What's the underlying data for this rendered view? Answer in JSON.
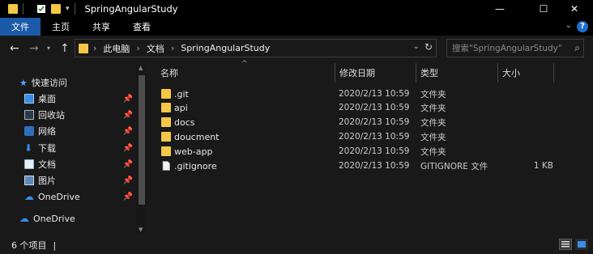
{
  "window": {
    "title": "SpringAngularStudy",
    "controls": {
      "minimize": "—",
      "maximize": "☐",
      "close": "✕"
    }
  },
  "ribbon": {
    "tabs": [
      "文件",
      "主页",
      "共享",
      "查看"
    ],
    "collapse_icon": "chevron-down-icon",
    "help": "?"
  },
  "address": {
    "crumbs": [
      "此电脑",
      "文档",
      "SpringAngularStudy"
    ],
    "search_placeholder": "搜索\"SpringAngularStudy\""
  },
  "nav": {
    "quick_access": "快速访问",
    "items": [
      {
        "label": "桌面",
        "icon": "desktop-icon",
        "pinned": true
      },
      {
        "label": "回收站",
        "icon": "recycle-bin-icon",
        "pinned": true
      },
      {
        "label": "网络",
        "icon": "network-icon",
        "pinned": true
      },
      {
        "label": "下载",
        "icon": "download-icon",
        "pinned": true
      },
      {
        "label": "文档",
        "icon": "documents-icon",
        "pinned": true
      },
      {
        "label": "图片",
        "icon": "pictures-icon",
        "pinned": true
      },
      {
        "label": "OneDrive",
        "icon": "onedrive-icon",
        "pinned": true
      }
    ],
    "onedrive_root": "OneDrive"
  },
  "columns": {
    "name": "名称",
    "date": "修改日期",
    "type": "类型",
    "size": "大小"
  },
  "files": [
    {
      "name": ".git",
      "date": "2020/2/13 10:59",
      "type": "文件夹",
      "size": "",
      "kind": "folder"
    },
    {
      "name": "api",
      "date": "2020/2/13 10:59",
      "type": "文件夹",
      "size": "",
      "kind": "folder"
    },
    {
      "name": "docs",
      "date": "2020/2/13 10:59",
      "type": "文件夹",
      "size": "",
      "kind": "folder"
    },
    {
      "name": "doucment",
      "date": "2020/2/13 10:59",
      "type": "文件夹",
      "size": "",
      "kind": "folder"
    },
    {
      "name": "web-app",
      "date": "2020/2/13 10:59",
      "type": "文件夹",
      "size": "",
      "kind": "folder"
    },
    {
      "name": ".gitignore",
      "date": "2020/2/13 10:59",
      "type": "GITIGNORE 文件",
      "size": "1 KB",
      "kind": "file"
    }
  ],
  "status": {
    "count": "6 个项目",
    "cursor": "|"
  },
  "colors": {
    "accent": "#1a5aa8",
    "folder": "#f4c747",
    "background": "#191919"
  }
}
